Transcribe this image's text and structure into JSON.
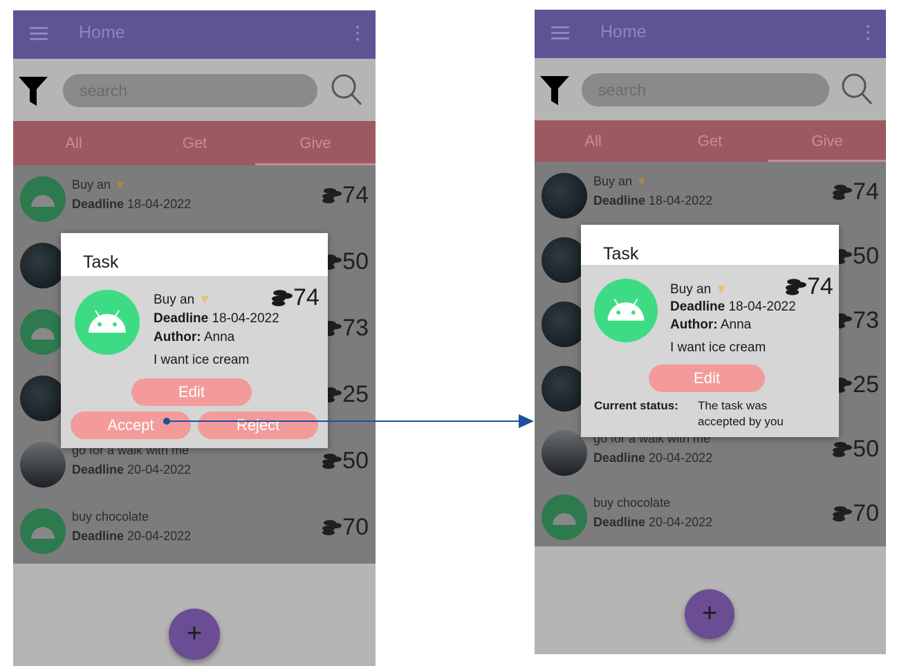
{
  "screens": [
    {
      "appbar": {
        "title": "Home"
      },
      "search": {
        "placeholder": "search"
      },
      "tabs": [
        "All",
        "Get",
        "Give"
      ],
      "list": [
        {
          "title": "Buy an",
          "deadline_label": "Deadline",
          "deadline": "18-04-2022",
          "coins": "74"
        },
        {
          "coins": "50"
        },
        {
          "coins": "73"
        },
        {
          "coins": "25"
        },
        {
          "title": "go for a walk with me",
          "deadline_label": "Deadline",
          "deadline": "20-04-2022",
          "coins": "50"
        },
        {
          "title": "buy chocolate",
          "deadline_label": "Deadline",
          "deadline": "20-04-2022",
          "coins": "70"
        }
      ],
      "fab_label": "+",
      "dialog": {
        "title": "Task",
        "task_title": "Buy an",
        "deadline_label": "Deadline",
        "deadline": "18-04-2022",
        "author_label": "Author:",
        "author": "Anna",
        "description": "I want ice cream",
        "coins": "74",
        "edit_label": "Edit",
        "accept_label": "Accept",
        "reject_label": "Reject"
      }
    },
    {
      "appbar": {
        "title": "Home"
      },
      "search": {
        "placeholder": "search"
      },
      "tabs": [
        "All",
        "Get",
        "Give"
      ],
      "list": [
        {
          "title": "Buy an",
          "deadline_label": "Deadline",
          "deadline": "18-04-2022",
          "coins": "74"
        },
        {
          "coins": "50"
        },
        {
          "coins": "73"
        },
        {
          "coins": "25"
        },
        {
          "title": "go for a walk with me",
          "deadline_label": "Deadline",
          "deadline": "20-04-2022",
          "coins": "50"
        },
        {
          "title": "buy chocolate",
          "deadline_label": "Deadline",
          "deadline": "20-04-2022",
          "coins": "70"
        }
      ],
      "fab_label": "+",
      "dialog": {
        "title": "Task",
        "task_title": "Buy an",
        "deadline_label": "Deadline",
        "deadline": "18-04-2022",
        "author_label": "Author:",
        "author": "Anna",
        "description": "I want ice cream",
        "coins": "74",
        "edit_label": "Edit",
        "status_label": "Current status:",
        "status_line1": "The task was",
        "status_line2": "accepted by you"
      }
    }
  ],
  "colors": {
    "appbar": "#5d5496",
    "tabbar": "#9c5960",
    "button": "#f39b9b",
    "fab": "#6b4d94",
    "connector": "#1f4e9c"
  }
}
